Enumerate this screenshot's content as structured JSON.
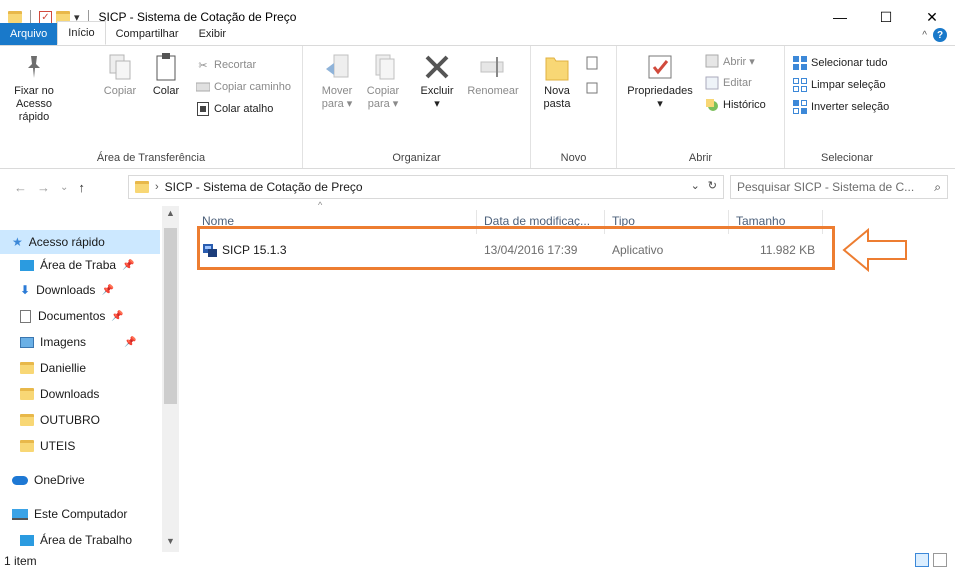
{
  "window": {
    "title": "SICP - Sistema de Cotação de Preço",
    "qa_dropdown": "▾",
    "minimize": "—",
    "maximize": "☐",
    "close": "✕"
  },
  "tabs": {
    "file": "Arquivo",
    "home": "Início",
    "share": "Compartilhar",
    "view": "Exibir",
    "collapse": "^",
    "help": "?"
  },
  "ribbon": {
    "clipboard": {
      "label": "Área de Transferência",
      "pin": "Fixar no\nAcesso rápido",
      "copy": "Copiar",
      "paste": "Colar",
      "cut": "Recortar",
      "copy_path": "Copiar caminho",
      "paste_shortcut": "Colar atalho"
    },
    "organize": {
      "label": "Organizar",
      "move": "Mover\npara ▾",
      "copy_to": "Copiar\npara ▾",
      "delete": "Excluir\n▾",
      "rename": "Renomear"
    },
    "new": {
      "label": "Novo",
      "new_folder": "Nova\npasta"
    },
    "open": {
      "label": "Abrir",
      "properties": "Propriedades\n▾",
      "open": "Abrir ▾",
      "edit": "Editar",
      "history": "Histórico"
    },
    "select": {
      "label": "Selecionar",
      "select_all": "Selecionar tudo",
      "select_none": "Limpar seleção",
      "invert": "Inverter seleção"
    }
  },
  "address": {
    "crumb_separator": "›",
    "path": "SICP - Sistema de Cotação de Preço",
    "dropdown": "⌄",
    "refresh": "↻",
    "search_placeholder": "Pesquisar SICP - Sistema de C..."
  },
  "nav": {
    "quick_access": "Acesso rápido",
    "items": [
      {
        "label": "Área de Traba",
        "icon": "desktop-icon"
      },
      {
        "label": "Downloads",
        "icon": "download-icon"
      },
      {
        "label": "Documentos",
        "icon": "documents-icon"
      },
      {
        "label": "Imagens",
        "icon": "pictures-icon"
      },
      {
        "label": "Daniellie",
        "icon": "folder-icon"
      },
      {
        "label": "Downloads",
        "icon": "folder-icon"
      },
      {
        "label": "OUTUBRO",
        "icon": "folder-icon"
      },
      {
        "label": "UTEIS",
        "icon": "folder-icon"
      }
    ],
    "onedrive": "OneDrive",
    "this_pc": "Este Computador",
    "desktop2": "Área de Trabalho"
  },
  "columns": {
    "name": "Nome",
    "date": "Data de modificaç...",
    "type": "Tipo",
    "size": "Tamanho"
  },
  "files": [
    {
      "name": "SICP 15.1.3",
      "date": "13/04/2016 17:39",
      "type": "Aplicativo",
      "size": "11.982 KB"
    }
  ],
  "status": {
    "count": "1 item"
  },
  "colors": {
    "accent": "#1979ca",
    "highlight": "#ed7d31",
    "folder": "#f8d775",
    "selection": "#cce8ff"
  }
}
